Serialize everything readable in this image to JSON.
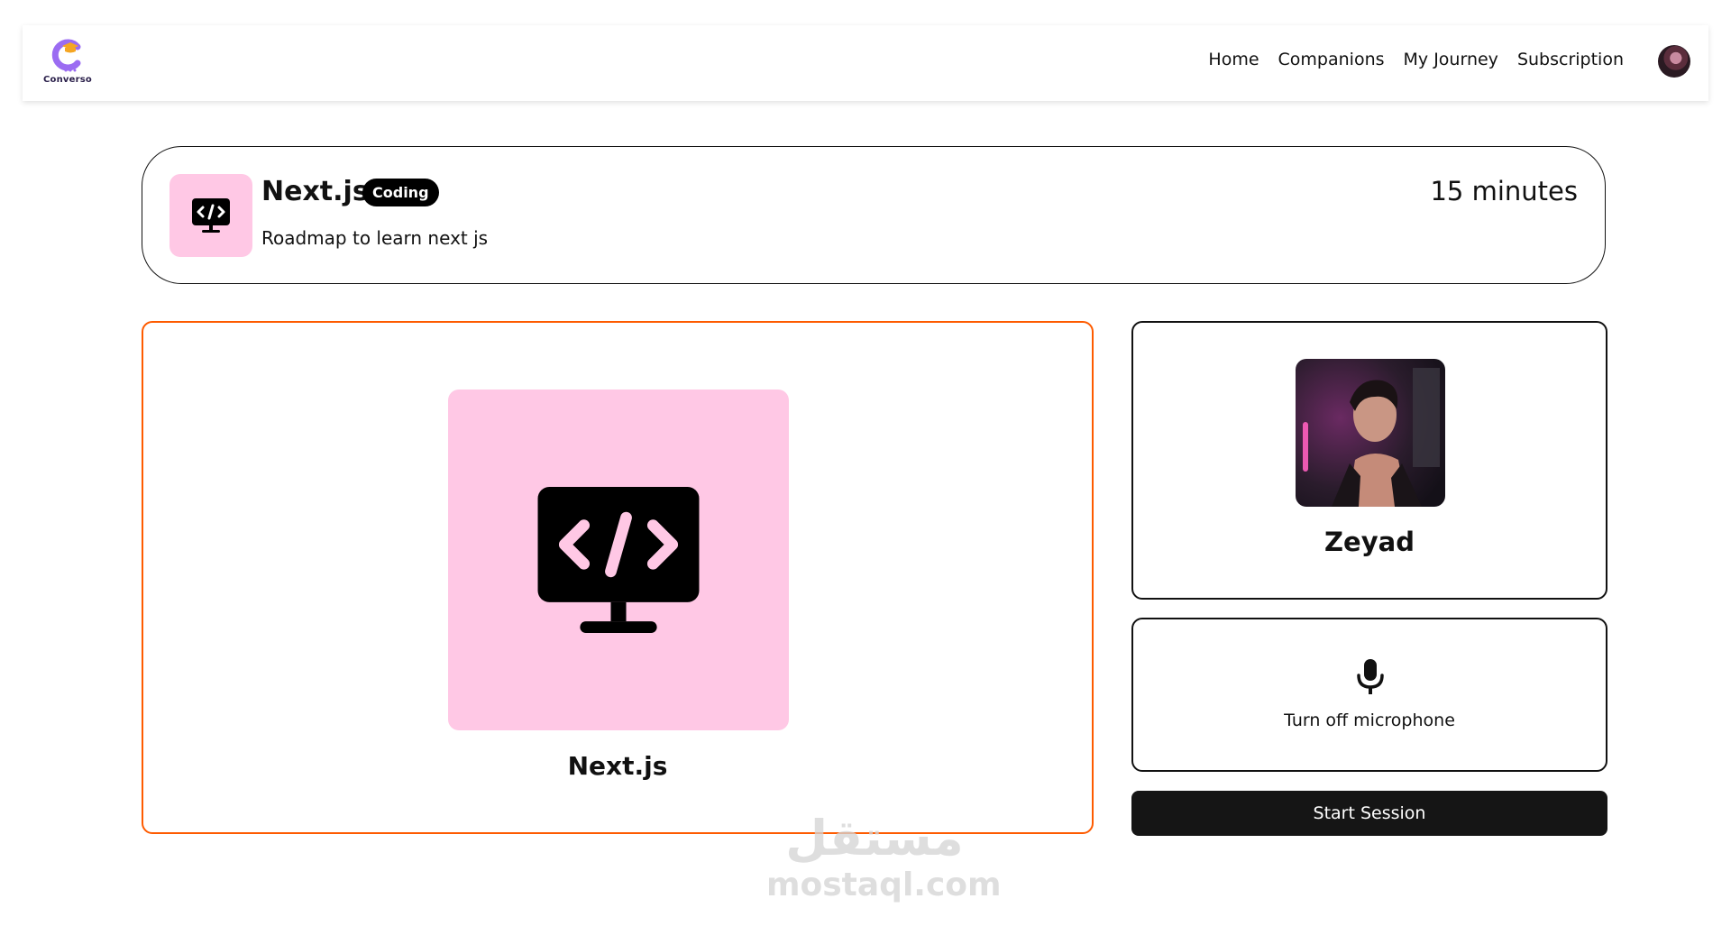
{
  "nav": {
    "logo_text": "Converso",
    "links": [
      "Home",
      "Companions",
      "My Journey",
      "Subscription"
    ]
  },
  "header": {
    "title": "Next.js",
    "badge": "Coding",
    "subtitle": "Roadmap to learn next js",
    "duration": "15 minutes",
    "icon": "code-monitor-icon"
  },
  "companion": {
    "name": "Next.js",
    "icon": "code-monitor-icon"
  },
  "user": {
    "name": "Zeyad"
  },
  "mic": {
    "label": "Turn off microphone",
    "icon": "microphone-icon"
  },
  "session": {
    "start_label": "Start Session"
  },
  "watermark": {
    "arabic": "مستقل",
    "latin": "mostaql.com"
  },
  "colors": {
    "accent_orange": "#fe5b00",
    "icon_bg_pink": "#ffc8e5",
    "button_dark": "#151515",
    "logo_purple": "#9b6cf2"
  }
}
